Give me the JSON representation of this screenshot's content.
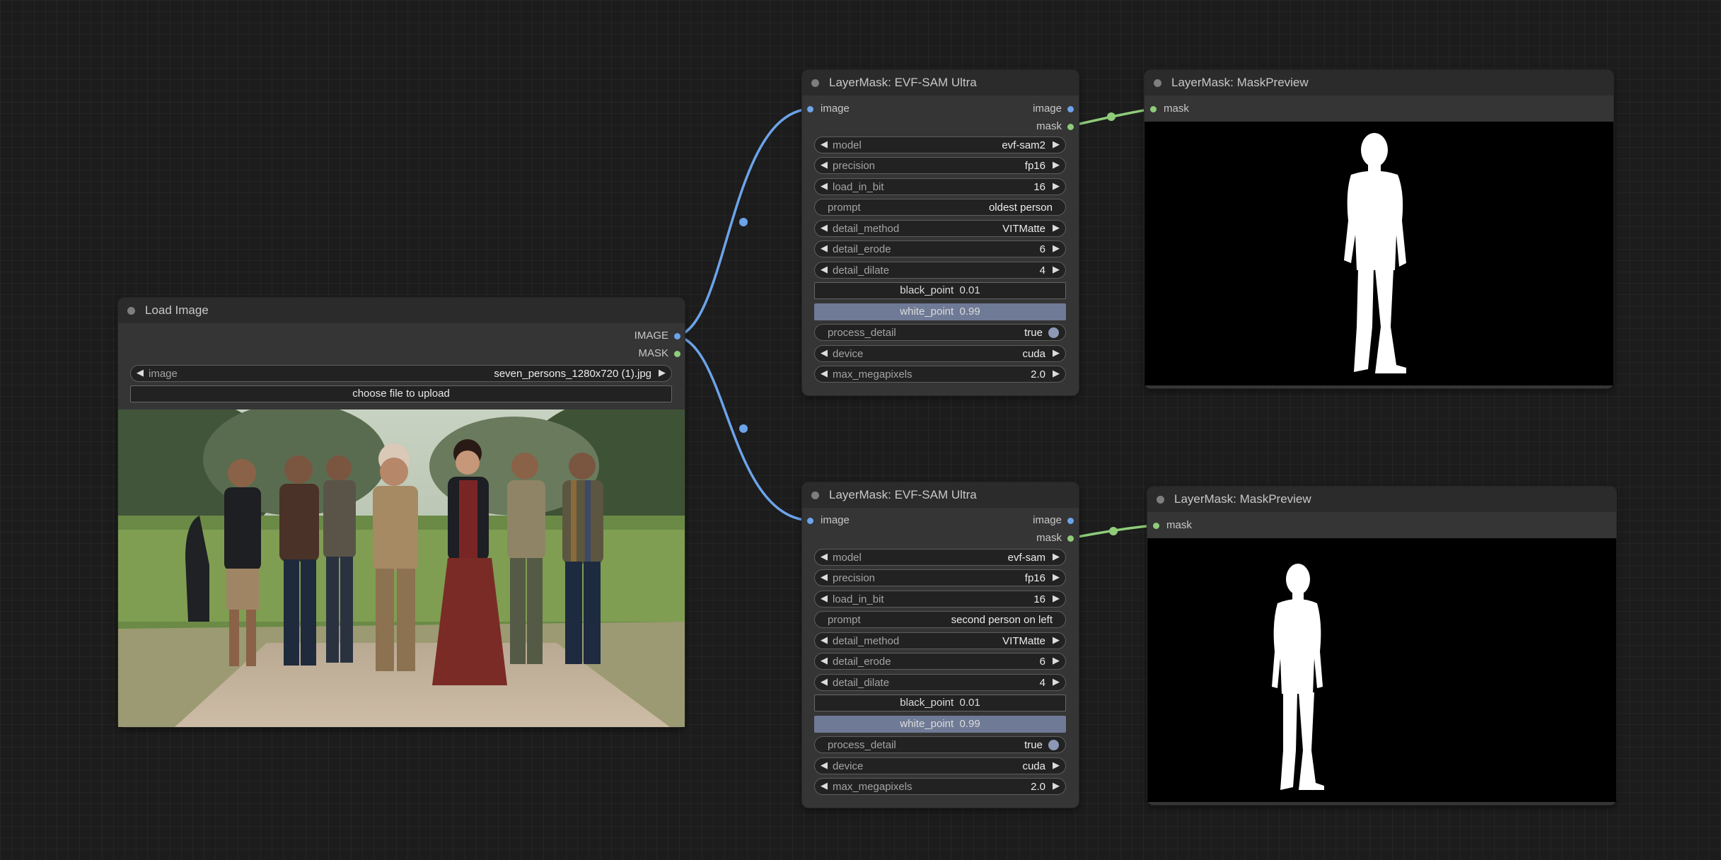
{
  "load_image": {
    "title": "Load Image",
    "outputs": [
      "IMAGE",
      "MASK"
    ],
    "image_widget": {
      "label": "image",
      "value": "seven_persons_1280x720 (1).jpg"
    },
    "upload_label": "choose file to upload"
  },
  "evf_nodes": [
    {
      "title": "LayerMask: EVF-SAM Ultra",
      "input": "image",
      "outputs": [
        "image",
        "mask"
      ],
      "model": {
        "label": "model",
        "value": "evf-sam2"
      },
      "precision": {
        "label": "precision",
        "value": "fp16"
      },
      "load_in_bit": {
        "label": "load_in_bit",
        "value": "16"
      },
      "prompt": {
        "label": "prompt",
        "value": "oldest person"
      },
      "detail_method": {
        "label": "detail_method",
        "value": "VITMatte"
      },
      "detail_erode": {
        "label": "detail_erode",
        "value": "6"
      },
      "detail_dilate": {
        "label": "detail_dilate",
        "value": "4"
      },
      "black_point": {
        "label": "black_point",
        "value": "0.01"
      },
      "white_point": {
        "label": "white_point",
        "value": "0.99"
      },
      "process_detail": {
        "label": "process_detail",
        "value": "true"
      },
      "device": {
        "label": "device",
        "value": "cuda"
      },
      "max_megapixels": {
        "label": "max_megapixels",
        "value": "2.0"
      }
    },
    {
      "title": "LayerMask: EVF-SAM Ultra",
      "input": "image",
      "outputs": [
        "image",
        "mask"
      ],
      "model": {
        "label": "model",
        "value": "evf-sam"
      },
      "precision": {
        "label": "precision",
        "value": "fp16"
      },
      "load_in_bit": {
        "label": "load_in_bit",
        "value": "16"
      },
      "prompt": {
        "label": "prompt",
        "value": "second person on left"
      },
      "detail_method": {
        "label": "detail_method",
        "value": "VITMatte"
      },
      "detail_erode": {
        "label": "detail_erode",
        "value": "6"
      },
      "detail_dilate": {
        "label": "detail_dilate",
        "value": "4"
      },
      "black_point": {
        "label": "black_point",
        "value": "0.01"
      },
      "white_point": {
        "label": "white_point",
        "value": "0.99"
      },
      "process_detail": {
        "label": "process_detail",
        "value": "true"
      },
      "device": {
        "label": "device",
        "value": "cuda"
      },
      "max_megapixels": {
        "label": "max_megapixels",
        "value": "2.0"
      }
    }
  ],
  "mask_previews": [
    {
      "title": "LayerMask: MaskPreview",
      "input": "mask"
    },
    {
      "title": "LayerMask: MaskPreview",
      "input": "mask"
    }
  ],
  "colors": {
    "canvas": "#1c1c1c",
    "node_body": "#353535",
    "node_title": "#2b2b2b",
    "image_link": "#6ca4ea",
    "mask_link": "#8fcc7a",
    "slider_fill": "#6f7a96"
  }
}
